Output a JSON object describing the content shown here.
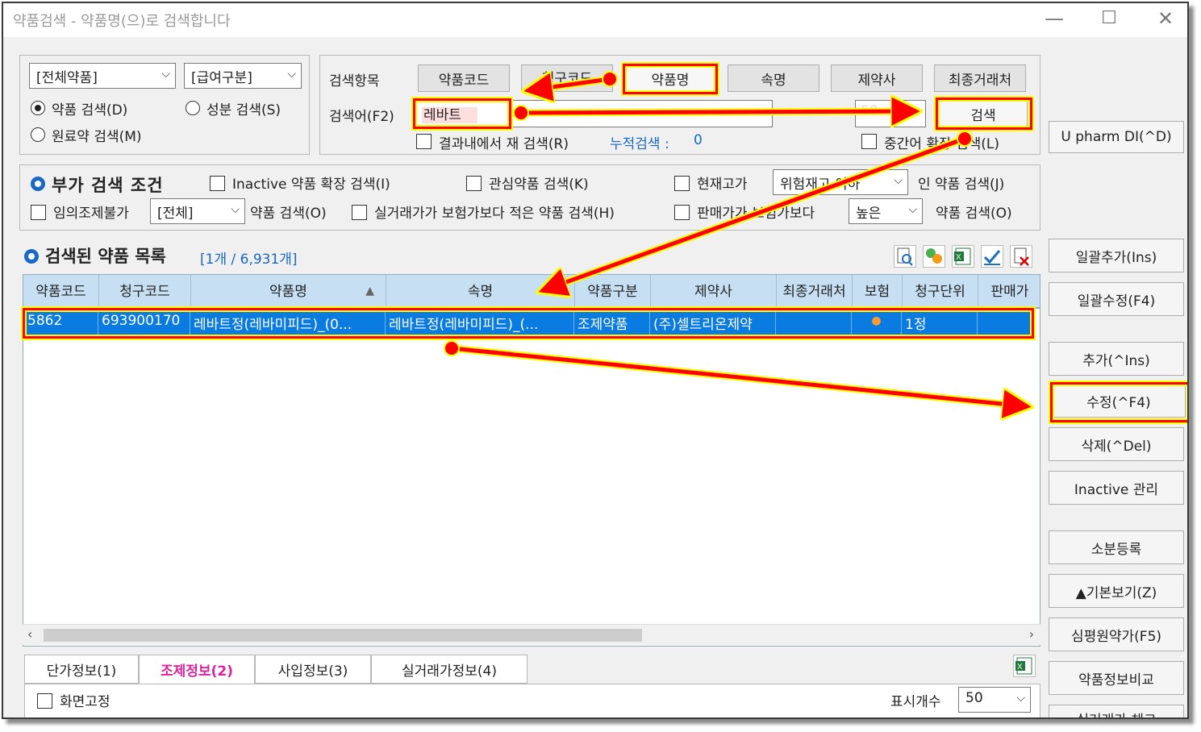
{
  "window": {
    "title": "약품검색 - 약품명(으)로 검색합니다",
    "minimize": "—",
    "maximize": "☐",
    "close": "✕"
  },
  "filters": {
    "category_combo": "[전체약품]",
    "payment_combo": "[급여구분]",
    "radio_drug": "약품 검색(D)",
    "radio_ingredient": "성분 검색(S)",
    "radio_raw": "원료약 검색(M)"
  },
  "search": {
    "items_label": "검색항목",
    "term_label": "검색어(F2)",
    "btn_code": "약품코드",
    "btn_claim": "청구코드",
    "btn_name": "약품명",
    "btn_alias": "속명",
    "btn_maker": "제약사",
    "btn_vendor": "최종거래처",
    "term_value": "레바트",
    "count_value": "50",
    "search_button": "검색",
    "research_label": "결과내에서 재 검색(R)",
    "cumulative_label": "누적검색 :",
    "cumulative_value": "0",
    "middle_label": "중간어 확장 검색(L)"
  },
  "side_top": {
    "upharm": "U pharm DI(^D)"
  },
  "extra": {
    "title": "부가 검색 조건",
    "inactive": "Inactive 약품 확장 검색(I)",
    "interest": "관심약품 검색(K)",
    "current_stock": "현재고가",
    "stock_combo": "위험재고 이하",
    "stock_suffix": "인 약품 검색(J)",
    "no_compound": "임의조제불가",
    "all_combo": "[전체]",
    "drug_search_o": "약품 검색(O)",
    "real_price": "실거래가가 보험가보다 적은 약품 검색(H)",
    "sale_price": "판매가가 보험가보다",
    "high_combo": "높은",
    "drug_search_o2": "약품 검색(O)"
  },
  "list": {
    "title": "검색된 약품 목록",
    "count": "[1개 / 6,931개]",
    "headers": [
      "약품코드",
      "청구코드",
      "약품명",
      "속명",
      "약품구분",
      "제약사",
      "최종거래처",
      "보험",
      "청구단위",
      "판매가"
    ],
    "row": {
      "code": "5862",
      "claim": "693900170",
      "name": "레바트정(레바미피드)_(0...",
      "alias": "레바트정(레바미피드)_(...",
      "kind": "조제약품",
      "maker": "(주)셀트리온제약",
      "vendor": "",
      "insurance": "●",
      "unit": "1정",
      "price": ""
    }
  },
  "tabs": [
    "단가정보(1)",
    "조제정보(2)",
    "사입정보(3)",
    "실거래가정보(4)"
  ],
  "bottom": {
    "fix_screen": "화면고정",
    "display_count_label": "표시개수",
    "display_count": "50"
  },
  "side_buttons": {
    "bulk_add": "일괄추가(Ins)",
    "bulk_edit": "일괄수정(F4)",
    "add": "추가(^Ins)",
    "edit": "수정(^F4)",
    "delete": "삭제(^Del)",
    "inactive": "Inactive 관리",
    "subdivide": "소분등록",
    "basic_view": "▲기본보기(Z)",
    "hira_price": "심평원약가(F5)",
    "compare": "약품정보비교",
    "real_check": "실거래가 체크"
  },
  "colors": {
    "selection": "#0a7be0",
    "header": "#c6dff3",
    "highlight": "#ff0000",
    "glow": "#ffff00",
    "accent_blue": "#1868c8"
  }
}
